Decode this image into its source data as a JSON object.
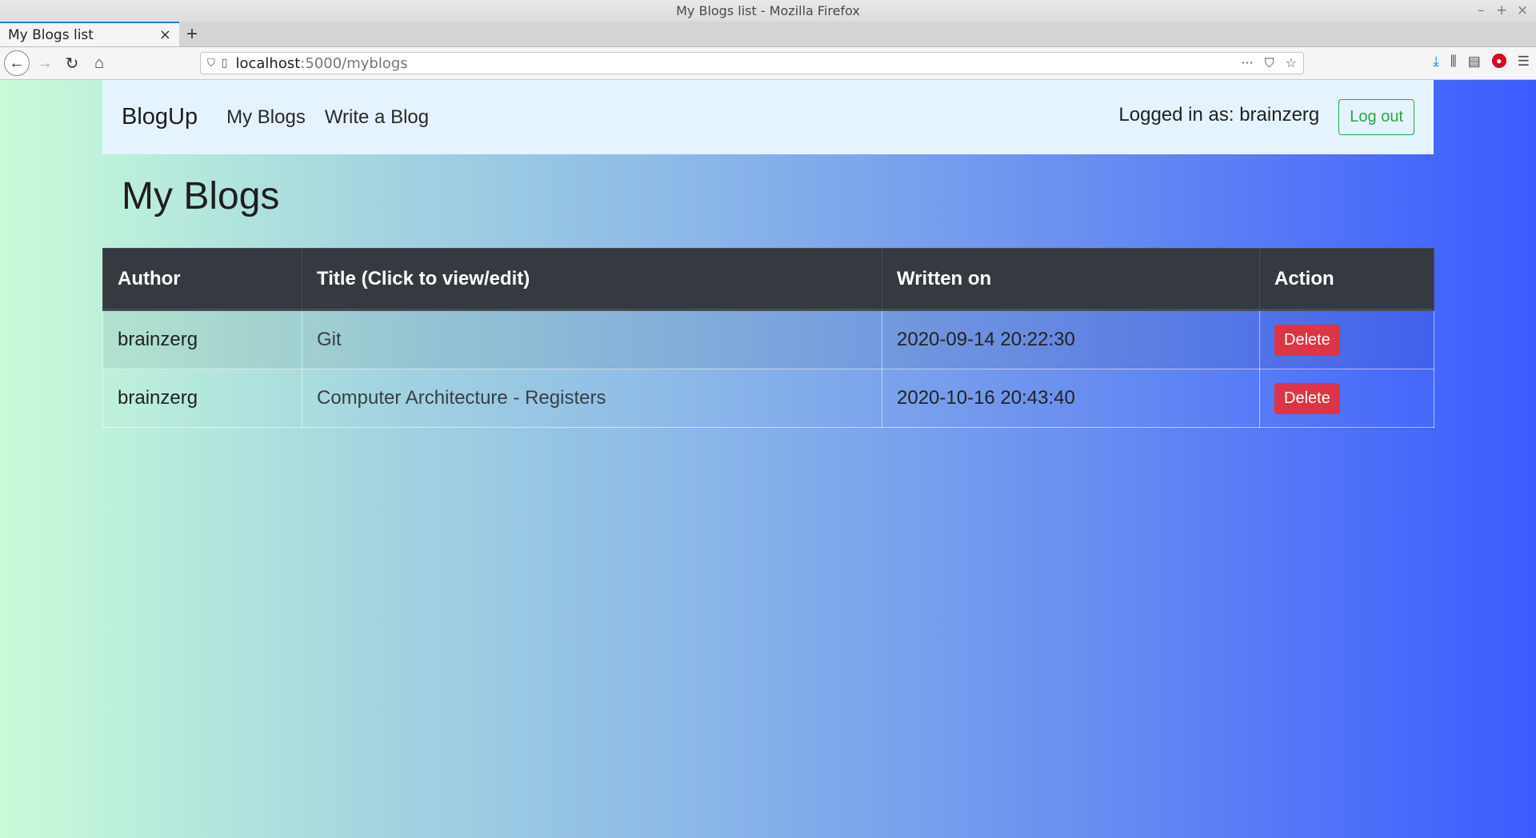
{
  "window": {
    "title": "My Blogs list - Mozilla Firefox",
    "controls": [
      "–",
      "+",
      "×"
    ]
  },
  "browser": {
    "tab_title": "My Blogs list",
    "tab_close": "×",
    "new_tab": "+",
    "url_host": "localhost",
    "url_path": ":5000/myblogs",
    "url_actions": [
      "···",
      "⛉",
      "☆"
    ]
  },
  "app": {
    "brand": "BlogUp",
    "nav_links": [
      "My Blogs",
      "Write a Blog"
    ],
    "logged_in_text": "Logged in as: brainzerg",
    "logout_label": "Log out"
  },
  "main": {
    "heading": "My Blogs",
    "table": {
      "headers": [
        "Author",
        "Title (Click to view/edit)",
        "Written on",
        "Action"
      ],
      "rows": [
        {
          "author": "brainzerg",
          "title": "Git",
          "written_on": "2020-09-14 20:22:30",
          "action": "Delete"
        },
        {
          "author": "brainzerg",
          "title": "Computer Architecture - Registers",
          "written_on": "2020-10-16 20:43:40",
          "action": "Delete"
        }
      ]
    }
  },
  "colors": {
    "header_bg": "#343a40",
    "delete_bg": "#dc3545",
    "logout_border": "#28a745",
    "navbar_bg": "#e5f3ff"
  }
}
